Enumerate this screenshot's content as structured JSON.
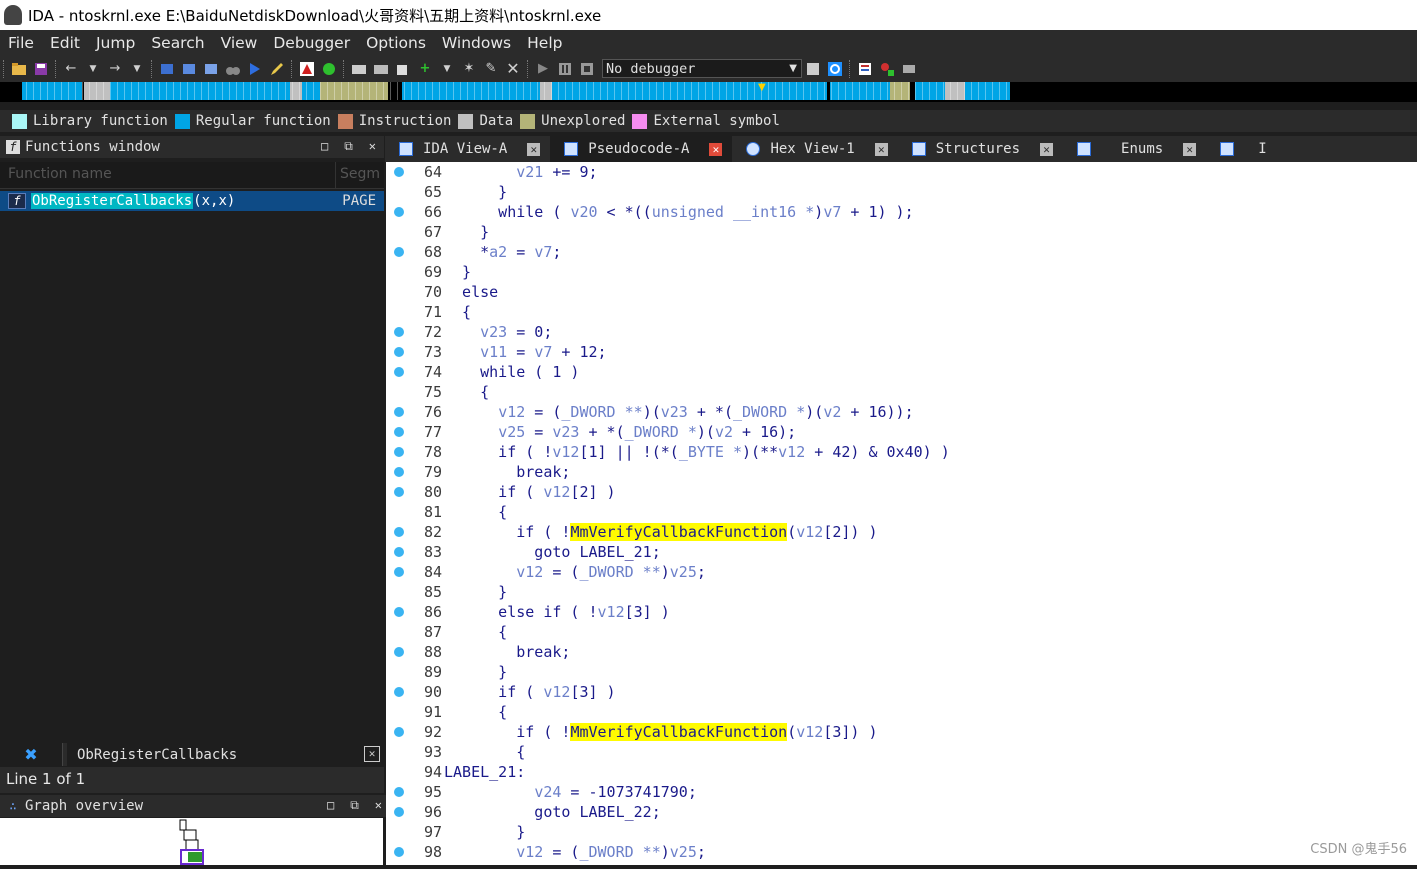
{
  "window": {
    "title": "IDA - ntoskrnl.exe E:\\BaiduNetdiskDownload\\火哥资料\\五期上资料\\ntoskrnl.exe"
  },
  "menu": [
    "File",
    "Edit",
    "Jump",
    "Search",
    "View",
    "Debugger",
    "Options",
    "Windows",
    "Help"
  ],
  "toolbar": {
    "debugger_select": "No debugger"
  },
  "legend": [
    {
      "label": "Library function",
      "color": "#aaf7f7"
    },
    {
      "label": "Regular function",
      "color": "#00a5e6"
    },
    {
      "label": "Instruction",
      "color": "#c87f5f"
    },
    {
      "label": "Data",
      "color": "#c0c0c0"
    },
    {
      "label": "Unexplored",
      "color": "#b4b478"
    },
    {
      "label": "External symbol",
      "color": "#f58cf0"
    }
  ],
  "functions_window": {
    "title": "Functions window",
    "col_name": "Function name",
    "col_segment": "Segm",
    "selected_function": "ObRegisterCallbacks",
    "selected_args": "(x,x)",
    "selected_segment": "PAGE",
    "bottom_tab": "ObRegisterCallbacks",
    "line_status": "Line 1 of 1"
  },
  "graph_overview": {
    "title": "Graph overview"
  },
  "tabs": [
    {
      "label": "IDA View-A",
      "active": false
    },
    {
      "label": "Pseudocode-A",
      "active": true
    },
    {
      "label": "Hex View-1",
      "active": false
    },
    {
      "label": "Structures",
      "active": false
    },
    {
      "label": "Enums",
      "active": false
    },
    {
      "label": "I",
      "active": false
    }
  ],
  "code_lines": [
    {
      "n": "64",
      "dot": true
    },
    {
      "n": "65",
      "dot": false
    },
    {
      "n": "66",
      "dot": true
    },
    {
      "n": "67",
      "dot": false
    },
    {
      "n": "68",
      "dot": true
    },
    {
      "n": "69",
      "dot": false
    },
    {
      "n": "70",
      "dot": false
    },
    {
      "n": "71",
      "dot": false
    },
    {
      "n": "72",
      "dot": true
    },
    {
      "n": "73",
      "dot": true
    },
    {
      "n": "74",
      "dot": true
    },
    {
      "n": "75",
      "dot": false
    },
    {
      "n": "76",
      "dot": true
    },
    {
      "n": "77",
      "dot": true
    },
    {
      "n": "78",
      "dot": true
    },
    {
      "n": "79",
      "dot": true
    },
    {
      "n": "80",
      "dot": true
    },
    {
      "n": "81",
      "dot": false
    },
    {
      "n": "82",
      "dot": true
    },
    {
      "n": "83",
      "dot": true
    },
    {
      "n": "84",
      "dot": true
    },
    {
      "n": "85",
      "dot": false
    },
    {
      "n": "86",
      "dot": true
    },
    {
      "n": "87",
      "dot": false
    },
    {
      "n": "88",
      "dot": true
    },
    {
      "n": "89",
      "dot": false
    },
    {
      "n": "90",
      "dot": true
    },
    {
      "n": "91",
      "dot": false
    },
    {
      "n": "92",
      "dot": true
    },
    {
      "n": "93",
      "dot": false
    },
    {
      "n": "94",
      "dot": false
    },
    {
      "n": "95",
      "dot": true
    },
    {
      "n": "96",
      "dot": true
    },
    {
      "n": "97",
      "dot": false
    },
    {
      "n": "98",
      "dot": true
    }
  ],
  "code_text": [
    [
      [
        "        ",
        ""
      ],
      [
        "v21",
        "v"
      ],
      [
        " += 9;",
        ""
      ]
    ],
    [
      [
        "      }",
        ""
      ]
    ],
    [
      [
        "      while ( ",
        ""
      ],
      [
        "v20",
        "v"
      ],
      [
        " < *((",
        ""
      ],
      [
        "unsigned __int16 *",
        "v"
      ],
      [
        ")",
        ""
      ],
      [
        "v7",
        "v"
      ],
      [
        " + 1) );",
        ""
      ]
    ],
    [
      [
        "    }",
        ""
      ]
    ],
    [
      [
        "    *",
        ""
      ],
      [
        "a2",
        "v"
      ],
      [
        " = ",
        ""
      ],
      [
        "v7",
        "v"
      ],
      [
        ";",
        ""
      ]
    ],
    [
      [
        "  }",
        ""
      ]
    ],
    [
      [
        "  else",
        ""
      ]
    ],
    [
      [
        "  {",
        ""
      ]
    ],
    [
      [
        "    ",
        ""
      ],
      [
        "v23",
        "v"
      ],
      [
        " = 0;",
        ""
      ]
    ],
    [
      [
        "    ",
        ""
      ],
      [
        "v11",
        "v"
      ],
      [
        " = ",
        ""
      ],
      [
        "v7",
        "v"
      ],
      [
        " + 12;",
        ""
      ]
    ],
    [
      [
        "    while ( 1 )",
        ""
      ]
    ],
    [
      [
        "    {",
        ""
      ]
    ],
    [
      [
        "      ",
        ""
      ],
      [
        "v12",
        "v"
      ],
      [
        " = (",
        ""
      ],
      [
        "_DWORD **",
        "v"
      ],
      [
        ")(",
        ""
      ],
      [
        "v23",
        "v"
      ],
      [
        " + *(",
        ""
      ],
      [
        "_DWORD *",
        "v"
      ],
      [
        ")(",
        ""
      ],
      [
        "v2",
        "v"
      ],
      [
        " + 16));",
        ""
      ]
    ],
    [
      [
        "      ",
        ""
      ],
      [
        "v25",
        "v"
      ],
      [
        " = ",
        ""
      ],
      [
        "v23",
        "v"
      ],
      [
        " + *(",
        ""
      ],
      [
        "_DWORD *",
        "v"
      ],
      [
        ")(",
        ""
      ],
      [
        "v2",
        "v"
      ],
      [
        " + 16);",
        ""
      ]
    ],
    [
      [
        "      if ( !",
        ""
      ],
      [
        "v12",
        "v"
      ],
      [
        "[1] || !(*(",
        ""
      ],
      [
        "_BYTE *",
        "v"
      ],
      [
        ")(**",
        ""
      ],
      [
        "v12",
        "v"
      ],
      [
        " + 42) & 0x40) )",
        ""
      ]
    ],
    [
      [
        "        break;",
        ""
      ]
    ],
    [
      [
        "      if ( ",
        ""
      ],
      [
        "v12",
        "v"
      ],
      [
        "[2] )",
        ""
      ]
    ],
    [
      [
        "      {",
        ""
      ]
    ],
    [
      [
        "        if ( !",
        ""
      ],
      [
        "MmVerifyCallbackFunction",
        "hl"
      ],
      [
        "(",
        ""
      ],
      [
        "v12",
        "v"
      ],
      [
        "[2]) )",
        ""
      ]
    ],
    [
      [
        "          goto LABEL_21;",
        ""
      ]
    ],
    [
      [
        "        ",
        ""
      ],
      [
        "v12",
        "v"
      ],
      [
        " = (",
        ""
      ],
      [
        "_DWORD **",
        "v"
      ],
      [
        ")",
        ""
      ],
      [
        "v25",
        "v"
      ],
      [
        ";",
        ""
      ]
    ],
    [
      [
        "      }",
        ""
      ]
    ],
    [
      [
        "      else if ( !",
        ""
      ],
      [
        "v12",
        "v"
      ],
      [
        "[3] )",
        ""
      ]
    ],
    [
      [
        "      {",
        ""
      ]
    ],
    [
      [
        "        break;",
        ""
      ]
    ],
    [
      [
        "      }",
        ""
      ]
    ],
    [
      [
        "      if ( ",
        ""
      ],
      [
        "v12",
        "v"
      ],
      [
        "[3] )",
        ""
      ]
    ],
    [
      [
        "      {",
        ""
      ]
    ],
    [
      [
        "        if ( !",
        ""
      ],
      [
        "MmVerifyCallbackFunction",
        "hl"
      ],
      [
        "(",
        ""
      ],
      [
        "v12",
        "v"
      ],
      [
        "[3]) )",
        ""
      ]
    ],
    [
      [
        "        {",
        ""
      ]
    ],
    [
      [
        "LABEL_21:",
        ""
      ]
    ],
    [
      [
        "          ",
        ""
      ],
      [
        "v24",
        "v"
      ],
      [
        " = -1073741790;",
        ""
      ]
    ],
    [
      [
        "          goto LABEL_22;",
        ""
      ]
    ],
    [
      [
        "        }",
        ""
      ]
    ],
    [
      [
        "        ",
        ""
      ],
      [
        "v12",
        "v"
      ],
      [
        " = (",
        ""
      ],
      [
        "_DWORD **",
        "v"
      ],
      [
        ")",
        ""
      ],
      [
        "v25",
        "v"
      ],
      [
        ";",
        ""
      ]
    ]
  ],
  "watermark": "CSDN @鬼手56"
}
